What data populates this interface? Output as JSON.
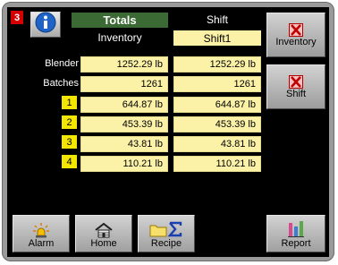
{
  "header": {
    "alarm_count": "3",
    "totals_title": "Totals",
    "shift_title": "Shift",
    "inventory_label": "Inventory",
    "shift_value": "Shift1"
  },
  "rows": [
    {
      "label": "Blender",
      "tag": "",
      "inventory": "1252.29 lb",
      "shift": "1252.29 lb"
    },
    {
      "label": "Batches",
      "tag": "",
      "inventory": "1261",
      "shift": "1261"
    },
    {
      "label": "",
      "tag": "1",
      "inventory": "644.87 lb",
      "shift": "644.87 lb"
    },
    {
      "label": "",
      "tag": "2",
      "inventory": "453.39 lb",
      "shift": "453.39 lb"
    },
    {
      "label": "",
      "tag": "3",
      "inventory": "43.81 lb",
      "shift": "43.81 lb"
    },
    {
      "label": "",
      "tag": "4",
      "inventory": "110.21 lb",
      "shift": "110.21 lb"
    }
  ],
  "side_buttons": {
    "inventory_reset": "Inventory",
    "shift_reset": "Shift"
  },
  "bottom_buttons": {
    "alarm": "Alarm",
    "home": "Home",
    "recipe": "Recipe",
    "report": "Report"
  },
  "icons": {
    "info": "info-icon",
    "reset": "red-x-icon",
    "alarm": "alarm-beacon-icon",
    "home": "home-icon",
    "recipe": "folder-sigma-icon",
    "report": "bar-chart-icon"
  },
  "colors": {
    "screen": "#000000",
    "totals_header": "#3c6a34",
    "value_cell": "#fbf2a8",
    "hopper_tag": "#f3e600",
    "alarm_badge": "#d40000",
    "button": "#bdbdbd"
  }
}
